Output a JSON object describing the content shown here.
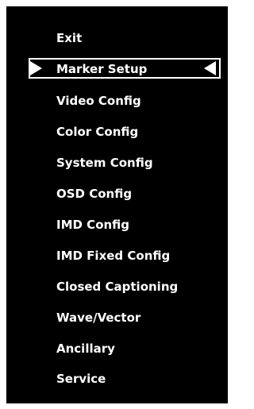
{
  "menu": {
    "items": [
      {
        "label": "Exit"
      },
      {
        "label": "Marker Setup",
        "selected": true
      },
      {
        "label": "Video Config"
      },
      {
        "label": "Color Config"
      },
      {
        "label": "System Config"
      },
      {
        "label": "OSD Config"
      },
      {
        "label": "IMD Config"
      },
      {
        "label": "IMD Fixed Config"
      },
      {
        "label": "Closed Captioning"
      },
      {
        "label": "Wave/Vector"
      },
      {
        "label": "Ancillary"
      },
      {
        "label": "Service"
      }
    ]
  },
  "colors": {
    "background": "#000000",
    "text": "#ffffff"
  }
}
